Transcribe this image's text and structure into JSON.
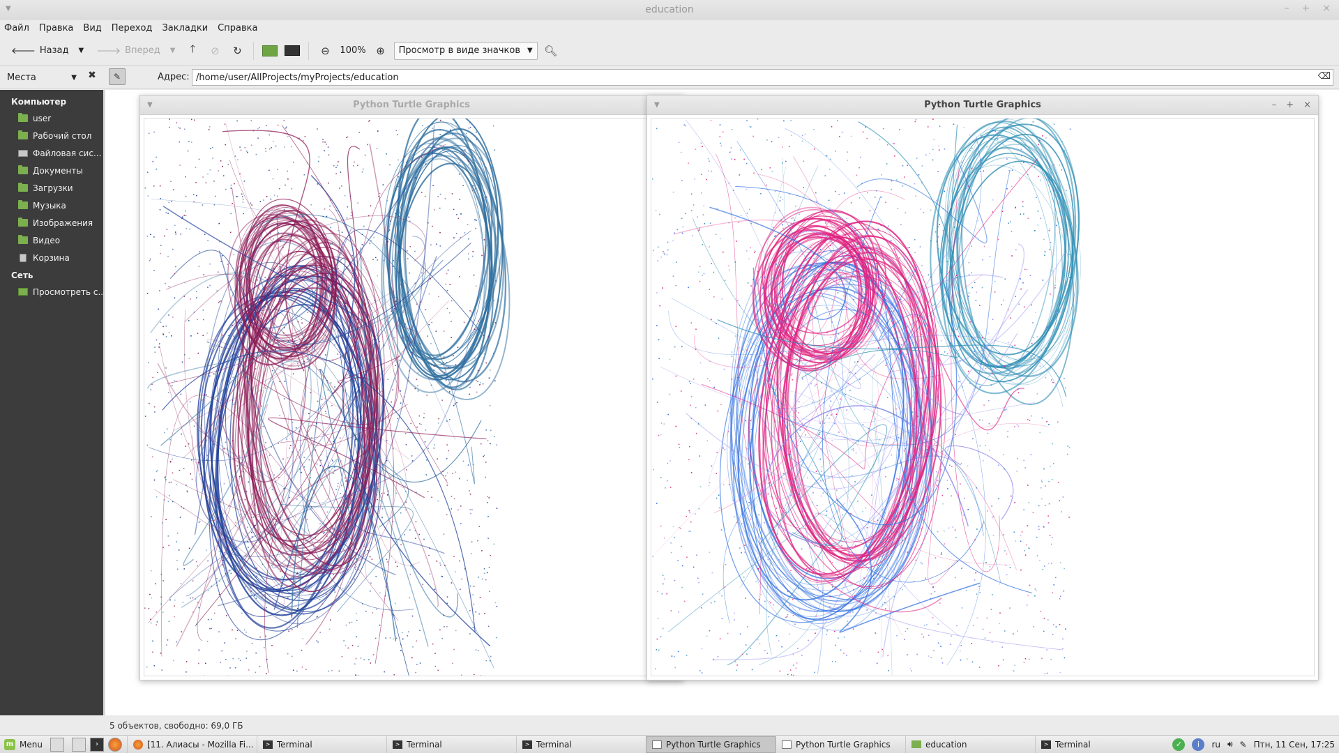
{
  "window": {
    "title": "education"
  },
  "menubar": [
    "Файл",
    "Правка",
    "Вид",
    "Переход",
    "Закладки",
    "Справка"
  ],
  "toolbar": {
    "back_label": "Назад",
    "forward_label": "Вперед",
    "zoom_level": "100%",
    "view_mode": "Просмотр в виде значков"
  },
  "address": {
    "places_label": "Места",
    "label": "Адрес:",
    "path": "/home/user/AllProjects/myProjects/education"
  },
  "sidebar": {
    "computer_heading": "Компьютер",
    "computer_items": [
      {
        "label": "user",
        "icon": "folder"
      },
      {
        "label": "Рабочий стол",
        "icon": "folder"
      },
      {
        "label": "Файловая сис...",
        "icon": "drive"
      },
      {
        "label": "Документы",
        "icon": "folder"
      },
      {
        "label": "Загрузки",
        "icon": "folder"
      },
      {
        "label": "Музыка",
        "icon": "folder"
      },
      {
        "label": "Изображения",
        "icon": "folder"
      },
      {
        "label": "Видео",
        "icon": "folder"
      },
      {
        "label": "Корзина",
        "icon": "trash"
      }
    ],
    "network_heading": "Сеть",
    "network_items": [
      {
        "label": "Просмотреть с...",
        "icon": "network"
      }
    ]
  },
  "status": {
    "text": "5 объектов, свободно: 69,0 ГБ"
  },
  "turtle_windows": [
    {
      "title": "Python Turtle Graphics",
      "active": false,
      "colors": [
        "#1f3f9a",
        "#8b1a55",
        "#2f6f9f"
      ]
    },
    {
      "title": "Python Turtle Graphics",
      "active": true,
      "colors": [
        "#2e6de0",
        "#e0207f",
        "#2f8fb5",
        "#8c85ef"
      ]
    }
  ],
  "taskbar": {
    "menu_label": "Menu",
    "tasks": [
      {
        "label": "[11. Алиасы - Mozilla Fi...",
        "icon": "firefox",
        "active": false
      },
      {
        "label": "Terminal",
        "icon": "terminal",
        "active": false
      },
      {
        "label": "Terminal",
        "icon": "terminal",
        "active": false
      },
      {
        "label": "Terminal",
        "icon": "terminal",
        "active": false
      },
      {
        "label": "Python Turtle Graphics",
        "icon": "window",
        "active": true
      },
      {
        "label": "Python Turtle Graphics",
        "icon": "window",
        "active": false
      },
      {
        "label": "education",
        "icon": "folder",
        "active": false
      },
      {
        "label": "Terminal",
        "icon": "terminal",
        "active": false
      }
    ],
    "language": "ru",
    "clock": "Птн, 11 Сен, 17:25"
  }
}
